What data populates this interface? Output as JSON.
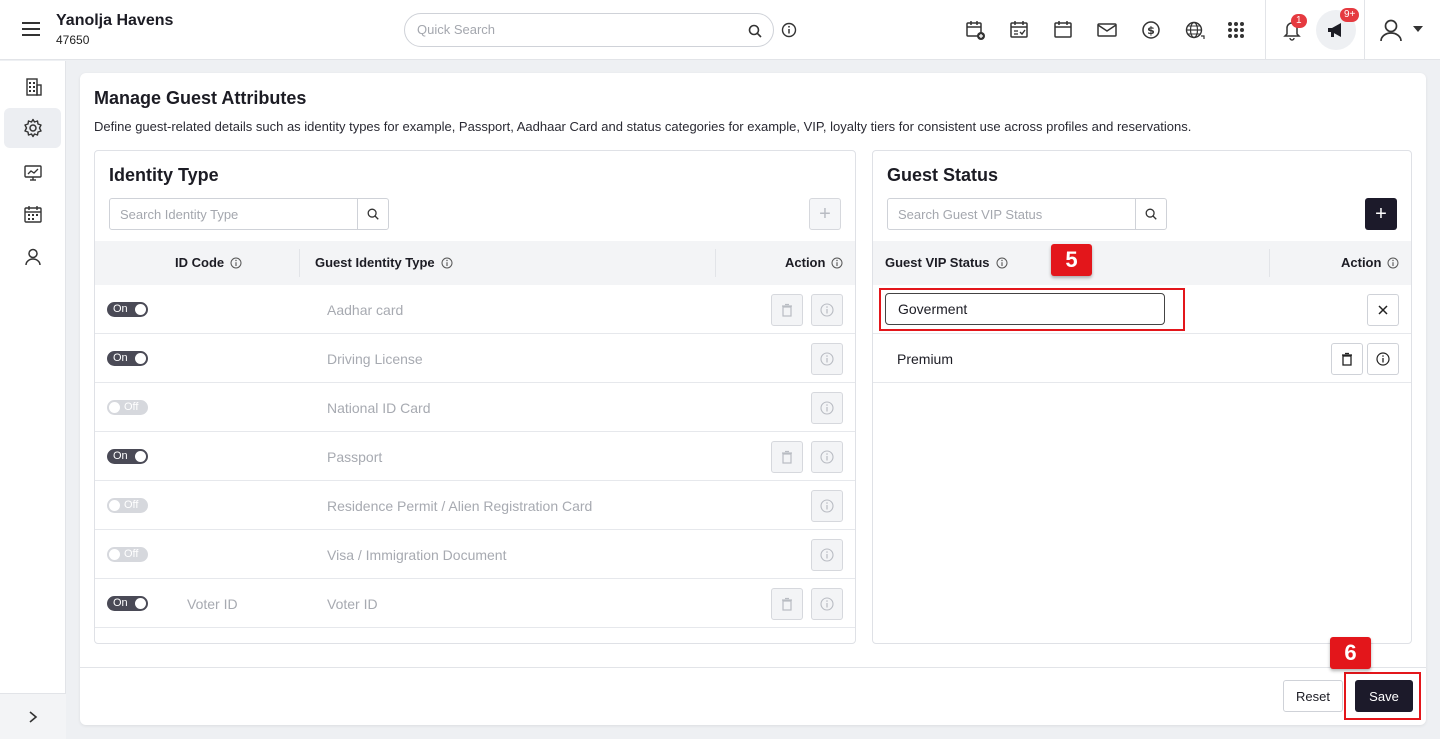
{
  "header": {
    "property_name": "Yanolja Havens",
    "property_id": "47650",
    "search_placeholder": "Quick Search",
    "notification_count": "1",
    "announcement_count": "9+"
  },
  "page": {
    "title": "Manage Guest Attributes",
    "description": "Define guest-related details such as identity types for example, Passport, Aadhaar Card and status categories for example, VIP, loyalty tiers for consistent use across profiles and reservations."
  },
  "identity_panel": {
    "title": "Identity Type",
    "search_placeholder": "Search Identity Type",
    "add_label": "+",
    "columns": {
      "code": "ID Code",
      "type": "Guest Identity Type",
      "action": "Action"
    },
    "rows": [
      {
        "toggle": "On",
        "code": "",
        "type": "Aadhar card"
      },
      {
        "toggle": "On",
        "code": "",
        "type": "Driving License"
      },
      {
        "toggle": "Off",
        "code": "",
        "type": "National ID Card"
      },
      {
        "toggle": "On",
        "code": "",
        "type": "Passport"
      },
      {
        "toggle": "Off",
        "code": "",
        "type": "Residence Permit / Alien Registration Card"
      },
      {
        "toggle": "Off",
        "code": "",
        "type": "Visa / Immigration Document"
      },
      {
        "toggle": "On",
        "code": "Voter ID",
        "type": "Voter ID"
      }
    ]
  },
  "status_panel": {
    "title": "Guest Status",
    "search_placeholder": "Search Guest VIP Status",
    "add_label": "+",
    "columns": {
      "status": "Guest VIP Status",
      "action": "Action"
    },
    "editing_value": "Goverment",
    "rows": [
      {
        "status": "Premium"
      }
    ]
  },
  "annotations": {
    "step5": "5",
    "step6": "6"
  },
  "footer": {
    "reset_label": "Reset",
    "save_label": "Save"
  },
  "colors": {
    "accent": "#1c1a2a",
    "annotation": "#e3161b",
    "badge": "#e53a40"
  }
}
